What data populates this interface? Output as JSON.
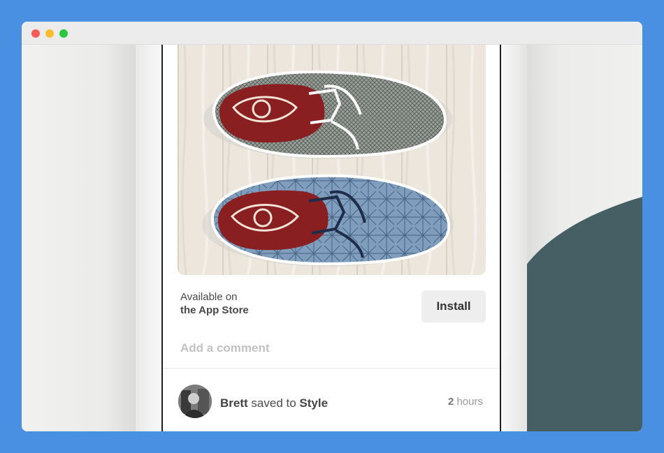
{
  "window": {
    "controls": [
      "close",
      "minimize",
      "maximize"
    ]
  },
  "pin": {
    "image_alt": "Two patterned slip-on sneakers on white wood",
    "availability_line1": "Available on",
    "availability_line2": "the App Store",
    "install_label": "Install"
  },
  "comment": {
    "placeholder": "Add a comment"
  },
  "activity": {
    "user": "Brett",
    "action": "saved to",
    "board": "Style",
    "time_value": "2",
    "time_unit": "hours"
  },
  "colors": {
    "page_background": "#4a90e2",
    "teal_shape": "#455f64",
    "install_button_bg": "#eeeeee",
    "placeholder_text": "#c2c2c2"
  },
  "icons": [
    "close-dot-icon",
    "minimize-dot-icon",
    "maximize-dot-icon"
  ]
}
